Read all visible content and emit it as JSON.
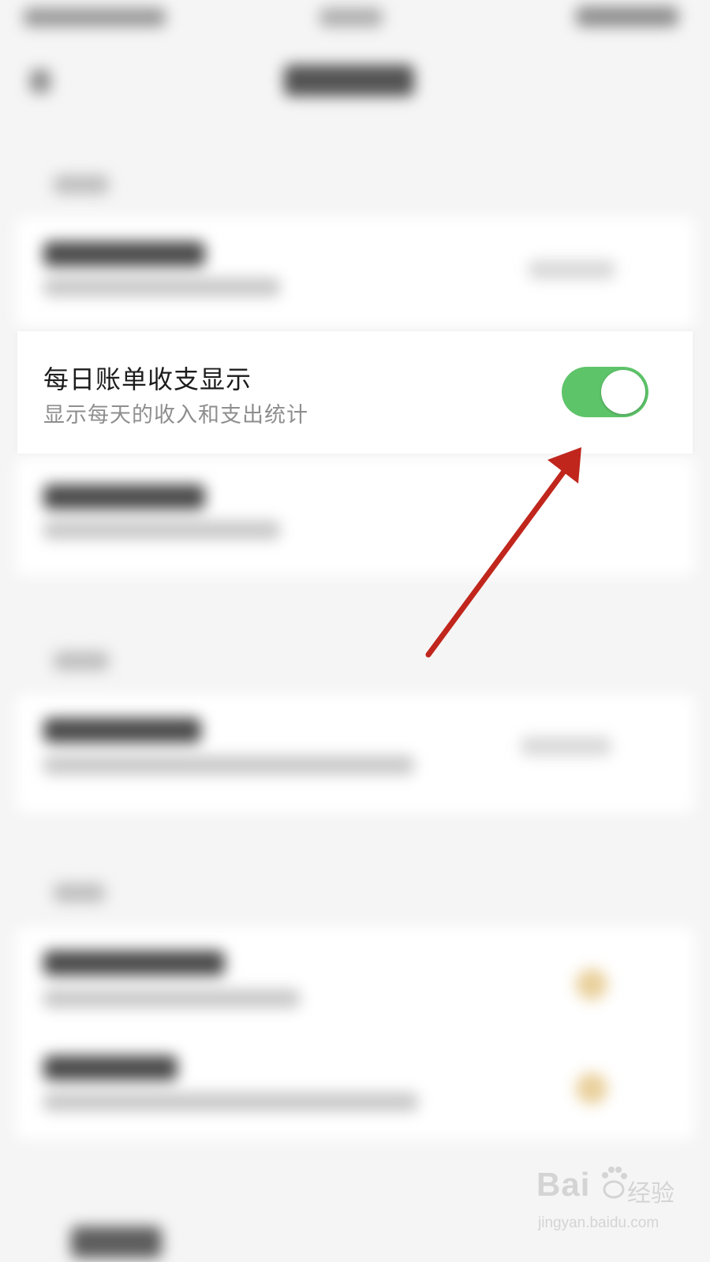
{
  "setting": {
    "title": "每日账单收支显示",
    "subtitle": "显示每天的收入和支出统计",
    "toggle_on": true
  },
  "colors": {
    "toggle_on": "#5ec46a",
    "arrow": "#c0261c",
    "background": "#f5f5f5"
  },
  "watermark": {
    "brand": "Bai",
    "brand_cn": "经验",
    "url": "jingyan.baidu.com"
  }
}
